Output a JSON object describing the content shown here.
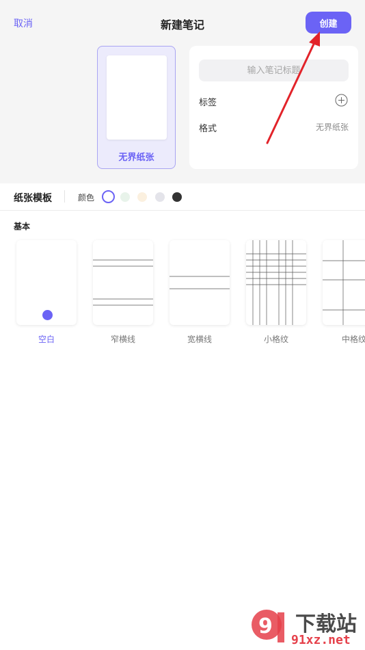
{
  "header": {
    "cancel_label": "取消",
    "title": "新建笔记",
    "create_label": "创建"
  },
  "preview": {
    "paper_label": "无界纸张"
  },
  "form": {
    "title_placeholder": "输入笔记标题",
    "tag_label": "标签",
    "format_label": "格式",
    "format_value": "无界纸张"
  },
  "toolbar": {
    "title": "纸张模板",
    "color_label": "颜色",
    "colors": [
      "#ffffff",
      "#e8f3ea",
      "#fbf0df",
      "#e4e4ea",
      "#333333"
    ]
  },
  "templates": {
    "section_title": "基本",
    "items": [
      {
        "label": "空白",
        "selected": true
      },
      {
        "label": "窄横线",
        "selected": false
      },
      {
        "label": "宽横线",
        "selected": false
      },
      {
        "label": "小格纹",
        "selected": false
      },
      {
        "label": "中格纹",
        "selected": false
      }
    ]
  },
  "accent_color": "#6b63f5",
  "watermark": {
    "text": "下载站",
    "url": "91xz.net"
  }
}
